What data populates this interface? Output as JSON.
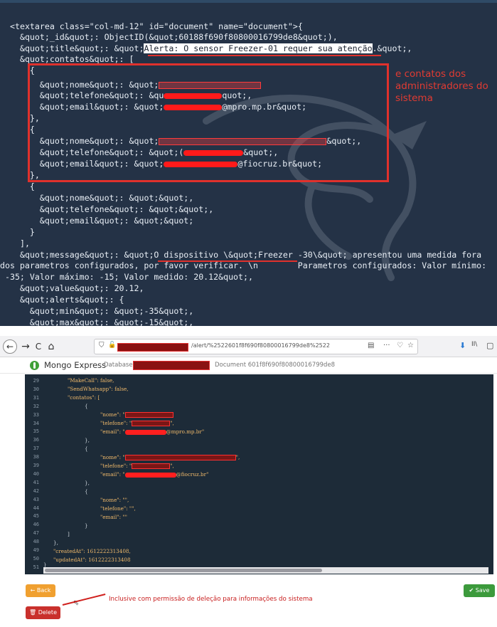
{
  "top": {
    "lines": {
      "l1": "<textarea class=\"col-md-12\" id=\"document\" name=\"document\">{",
      "l2": "  &quot;_id&quot;: ObjectID(&quot;60188f690f80800016799de8&quot;),",
      "l3_pre": "  &quot;title&quot;: &quot;",
      "l3_hl": "Alerta: O sensor Freezer-01 requer sua atenção",
      "l3_post": ".&quot;,",
      "l4": "  &quot;contatos&quot;: [",
      "l5": "    {",
      "l6": "      &quot;nome&quot;: &quot;",
      "l7_pre": "      &quot;telefone&quot;: &qu",
      "l7_post": "quot;,",
      "l8_pre": "      &quot;email&quot;: &quot;",
      "l8_post": "@mpro.mp.br&quot;",
      "l9": "    },",
      "l10": "    {",
      "l11_pre": "      &quot;nome&quot;: &quot;",
      "l11_post": "&quot;,",
      "l12_pre": "      &quot;telefone&quot;: &quot;(",
      "l12_post": "&quot;,",
      "l13_pre": "      &quot;email&quot;: &quot;",
      "l13_post": "@fiocruz.br&quot;",
      "l14": "    },",
      "l15": "    {",
      "l16": "      &quot;nome&quot;: &quot;&quot;,",
      "l17": "      &quot;telefone&quot;: &quot;&quot;,",
      "l18": "      &quot;email&quot;: &quot;&quot;",
      "l19": "    }",
      "l20": "  ],",
      "l21": "  &quot;message&quot;: &quot;O dispositivo \\&quot;Freezer -30\\&quot; apresentou uma medida fora",
      "l22": "dos parametros configurados, por favor verificar. \\n        Parametros configurados: Valor mínimo:",
      "l23": " -35; Valor máximo: -15; Valor medido: 20.12&quot;,",
      "l24": "  &quot;value&quot;: 20.12,",
      "l25": "  &quot;alerts&quot;: {",
      "l26": "    &quot;min&quot;: &quot;-35&quot;,",
      "l27": "    &quot;max&quot;: &quot;-15&quot;,"
    },
    "annotation": "e contatos dos administradores do sistema"
  },
  "browser": {
    "back_glyph": "←",
    "forward_glyph": "→",
    "reload_glyph": "C",
    "home_glyph": "⌂",
    "url_suffix": "/alert/%2522601f8f690f80800016799de8%2522",
    "reader_glyph": "▤",
    "more_glyph": "···",
    "pocket_glyph": "♡",
    "star_glyph": "☆",
    "download_glyph": "⬇",
    "library_glyph": "II\\",
    "sidebar_glyph": "▢"
  },
  "mongo": {
    "title": "Mongo Express",
    "db_label": "Database",
    "doc_label": "Document 601f8f690f80800016799de8"
  },
  "editor": {
    "line_numbers": [
      "29",
      "30",
      "31",
      "32",
      "33",
      "34",
      "35",
      "36",
      "37",
      "38",
      "39",
      "40",
      "41",
      "42",
      "43",
      "44",
      "45",
      "46",
      "47",
      "48",
      "49",
      "50",
      "51"
    ],
    "l29": "\"MakeCall\": false,",
    "l30": "\"SendWhatsapp\": false,",
    "l31": "\"contatos\": [",
    "l32": "{",
    "l33_pre": "\"nome\": \"",
    "l34_pre": "\"telefone\": \"",
    "l34_post": "\",",
    "l35_pre": "\"email\": \"",
    "l35_post": "@mpro.mp.br\"",
    "l36": "},",
    "l37": "{",
    "l38_pre": "\"nome\": \"",
    "l38_post": "\",",
    "l39_pre": "\"telefone\": \"",
    "l39_post": "\",",
    "l40_pre": "\"email\": \"",
    "l40_post": "@fiocruz.br\"",
    "l41": "},",
    "l42": "{",
    "l43": "\"nome\": \"\",",
    "l44": "\"telefone\": \"\",",
    "l45": "\"email\": \"\"",
    "l46": "}",
    "l47": "]",
    "l48": "},",
    "l49": "\"createdAt\": 1612222313408,",
    "l50": "\"updatedAt\": 1612222313408",
    "l51": "}"
  },
  "buttons": {
    "back": "← Back",
    "delete": "🗑 Delete",
    "save": "✔ Save"
  },
  "delete_annotation": "Inclusive com permissão de deleção para informações do sistema",
  "colors": {
    "annotation_red": "#e0312c",
    "terminal_bg": "#243246",
    "editor_bg": "#1d2b38",
    "back_button": "#f0a030",
    "delete_button": "#c9302c",
    "save_button": "#3c9a3c"
  }
}
